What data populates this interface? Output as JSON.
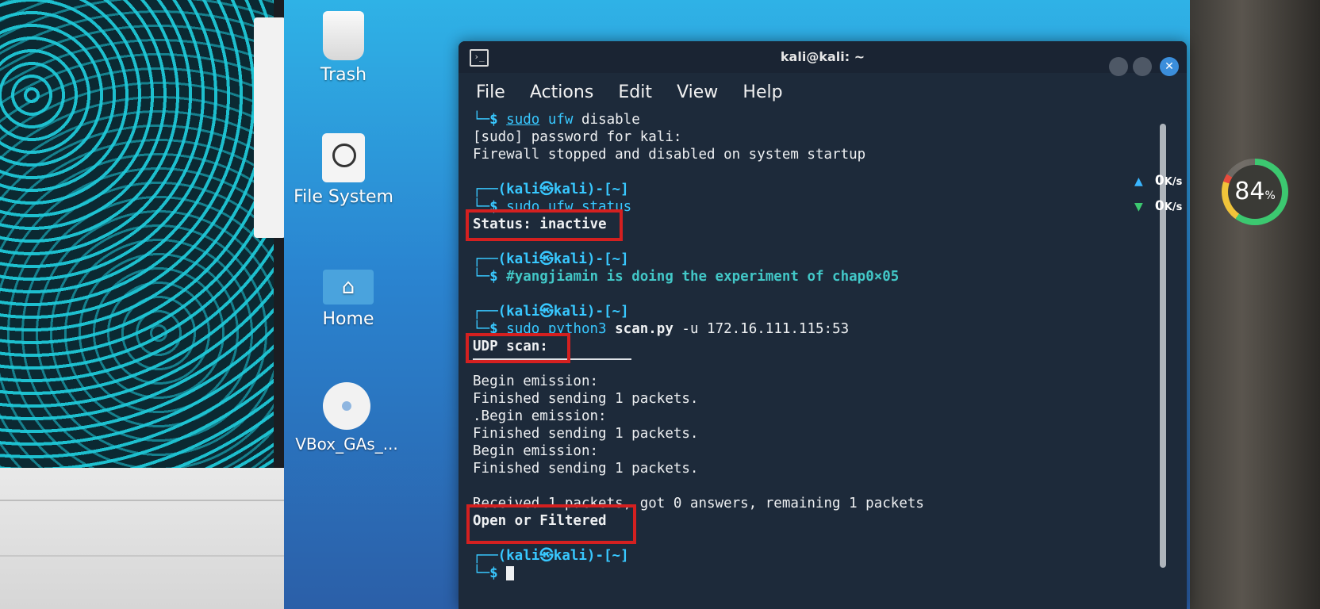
{
  "desktop": {
    "icons": [
      {
        "label": "Trash",
        "icon": "trash-icon"
      },
      {
        "label": "File System",
        "icon": "drive-icon"
      },
      {
        "label": "Home",
        "icon": "home-icon"
      },
      {
        "label": "VBox_GAs_...",
        "icon": "cd-icon"
      }
    ]
  },
  "terminal": {
    "title": "kali@kali: ~",
    "menu": [
      "File",
      "Actions",
      "Edit",
      "View",
      "Help"
    ],
    "lines": {
      "l1_prefix": "└─$ ",
      "l1_sudo": "sudo",
      "l1_ufw": "ufw",
      "l1_rest": " disable",
      "l2": "[sudo] password for kali:",
      "l3": "Firewall stopped and disabled on system startup",
      "p1": "┌──(kali㉿kali)-[~]",
      "l4_prefix": "└─$ ",
      "l4_cmd": "sudo ufw status",
      "l5": "Status: inactive",
      "p2": "┌──(kali㉿kali)-[~]",
      "l6_prefix": "└─$ ",
      "l6_comment": "#yangjiamin is doing the experiment of chap0×05",
      "p3": "┌──(kali㉿kali)-[~]",
      "l7_prefix": "└─$ ",
      "l7_sudo": "sudo python3 ",
      "l7_script": "scan.py",
      "l7_args": " -u 172.16.111.115:53",
      "l8": "UDP scan:",
      "l9": "Begin emission:",
      "l10": "Finished sending 1 packets.",
      "l11": ".Begin emission:",
      "l12": "Finished sending 1 packets.",
      "l13": "Begin emission:",
      "l14": "Finished sending 1 packets.",
      "l15": "Received 1 packets, got 0 answers, remaining 1 packets",
      "l16": "Open or Filtered",
      "p4": "┌──(kali㉿kali)-[~]",
      "l17_prefix": "└─$ "
    }
  },
  "network": {
    "up_value": "0",
    "up_unit": "K/s",
    "down_value": "0",
    "down_unit": "K/s",
    "gauge_value": "84",
    "gauge_unit": "%",
    "gauge_fraction": 0.84
  },
  "colors": {
    "prompt": "#38c8ff",
    "highlight_box": "#d42020",
    "terminal_bg": "#1d2a3a"
  }
}
